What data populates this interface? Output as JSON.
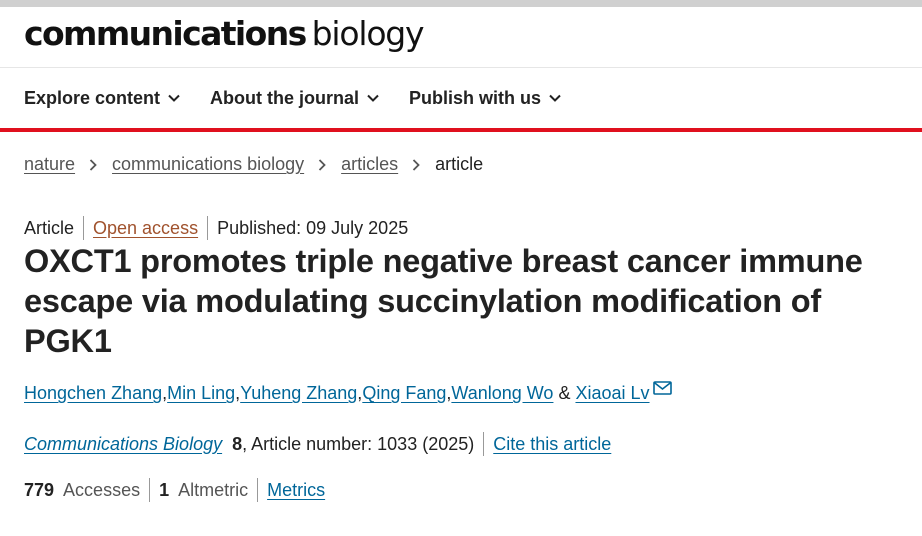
{
  "header": {
    "brand_bold": "communications",
    "brand_light": "biology"
  },
  "nav": {
    "items": [
      {
        "label": "Explore content"
      },
      {
        "label": "About the journal"
      },
      {
        "label": "Publish with us"
      }
    ]
  },
  "breadcrumb": {
    "items": [
      "nature",
      "communications biology",
      "articles"
    ],
    "current": "article"
  },
  "article": {
    "type": "Article",
    "access": "Open access",
    "published": "Published: 09 July 2025",
    "title": "OXCT1 promotes triple negative breast cancer immune escape via modulating succinylation modification of PGK1",
    "authors": [
      "Hongchen Zhang",
      "Min Ling",
      "Yuheng Zhang",
      "Qing Fang",
      "Wanlong Wo",
      "Xiaoai Lv"
    ],
    "author_separator": ", ",
    "author_last_separator": " & ",
    "citation": {
      "journal": "Communications Biology",
      "volume": "8",
      "article_number": ", Article number: 1033 (2025)",
      "cite_label": "Cite this article"
    },
    "metrics": {
      "accesses_count": "779",
      "accesses_label": "Accesses",
      "altmetric_count": "1",
      "altmetric_label": "Altmetric",
      "metrics_link": "Metrics"
    }
  },
  "colors": {
    "accent_red": "#e0101e",
    "link_blue": "#006699",
    "open_access": "#a0522d"
  },
  "icons": {
    "nav_chevron": "chevron-down-icon",
    "breadcrumb_separator": "chevron-right-icon",
    "corresponding_author": "mail-icon"
  }
}
